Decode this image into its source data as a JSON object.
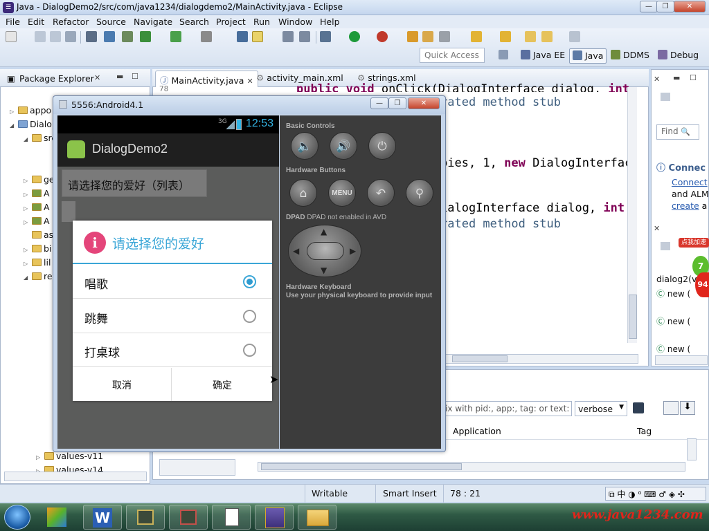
{
  "window": {
    "title": "Java - DialogDemo2/src/com/java1234/dialogdemo2/MainActivity.java - Eclipse",
    "icon": "eclipse-icon"
  },
  "menu": [
    "File",
    "Edit",
    "Refactor",
    "Source",
    "Navigate",
    "Search",
    "Project",
    "Run",
    "Window",
    "Help"
  ],
  "toolbar": {
    "quick_access_placeholder": "Quick Access",
    "perspectives": [
      "Java EE",
      "Java",
      "DDMS",
      "Debug"
    ]
  },
  "package_explorer": {
    "tab_label": "Package Explorer",
    "rows": [
      "appo",
      "Dialo",
      "src",
      "gen",
      "A",
      "A",
      "A",
      "as",
      "bi",
      "lil",
      "re",
      "values-v11",
      "values-v14"
    ]
  },
  "editor": {
    "tabs": [
      "MainActivity.java",
      "activity_main.xml",
      "strings.xml"
    ],
    "lines": {
      "l1_kw": "public void",
      "l1_rest": " onClick(DialogInterface dialog, ",
      "l1_kw2": "int",
      "l2": "rated method stub",
      "l3_rest": "bies, 1, ",
      "l3_kw": "new",
      "l3_tail": " DialogInterfac",
      "l4_rest": "ialogInterface dialog, ",
      "l4_kw": "int",
      "l5": "rated method stub",
      "gutter": "78"
    }
  },
  "right_panel": {
    "find_placeholder": "Find",
    "connect_title": "Connec",
    "connect_link": "Connect",
    "and_alm": "and ALM",
    "create_link": "create",
    "create_rest": " a",
    "outline_label": "dialog2(v",
    "new_items": [
      "new (",
      "new (",
      "new ("
    ],
    "badge_text": "点我加速",
    "badge_number": "94",
    "badge_percent": "7"
  },
  "console": {
    "filter_placeholder": "ix with pid:, app:, tag: or text: t",
    "level_select": "verbose",
    "columns": [
      "Application",
      "Tag"
    ]
  },
  "status": {
    "writable": "Writable",
    "insert_mode": "Smart Insert",
    "position": "78 : 21"
  },
  "emulator": {
    "title": "5556:Android4.1",
    "clock": "12:53",
    "signal": "3G",
    "app_title": "DialogDemo2",
    "list_button": "请选择您的爱好（列表）",
    "controls": {
      "basic_controls": "Basic Controls",
      "hardware_buttons": "Hardware Buttons",
      "menu_label": "MENU",
      "dpad_label": "DPAD not enabled in AVD",
      "keyboard_title": "Hardware Keyboard",
      "keyboard_sub": "Use your physical keyboard to provide input"
    },
    "dialog": {
      "title": "请选择您的爱好",
      "options": [
        {
          "label": "唱歌",
          "selected": true
        },
        {
          "label": "跳舞",
          "selected": false
        },
        {
          "label": "打桌球",
          "selected": false
        }
      ],
      "cancel": "取消",
      "ok": "确定"
    }
  },
  "taskbar": {
    "watermark": "www.java1234.com"
  },
  "colors": {
    "accent": "#3aa6d7",
    "dialog_icon": "#e4457a",
    "keyword": "#7f0055",
    "comment": "#3f5f7f"
  }
}
